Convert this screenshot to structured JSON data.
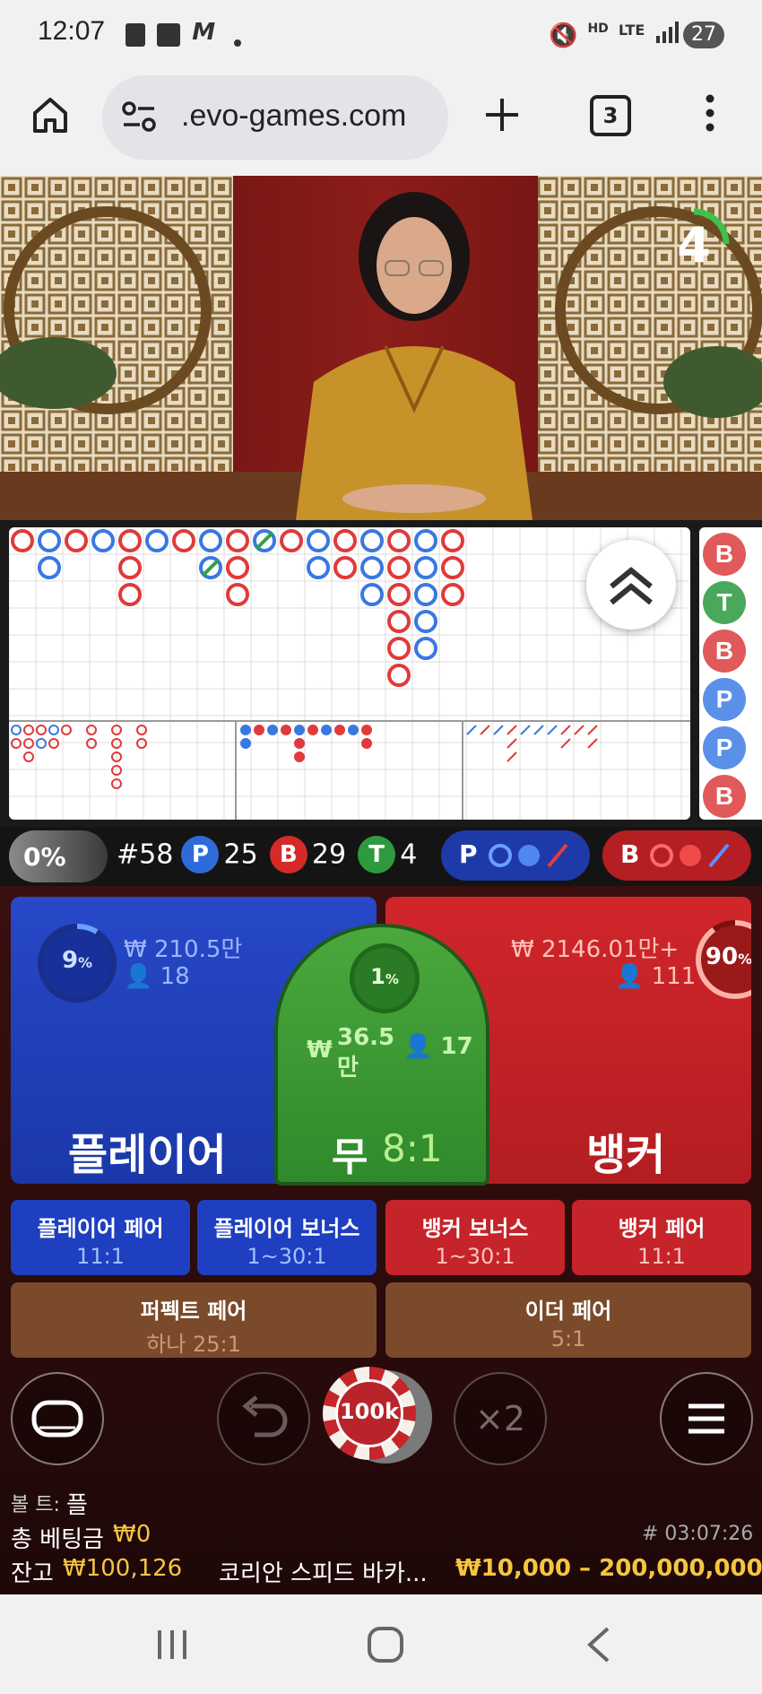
{
  "status_bar": {
    "time": "12:07",
    "battery": "27"
  },
  "browser": {
    "url": ".evo-games.com",
    "tab_count": "3"
  },
  "video": {
    "countdown": "4"
  },
  "roadmap": {
    "side_results": [
      "B",
      "T",
      "B",
      "P",
      "P",
      "B"
    ]
  },
  "stats": {
    "percent": "0%",
    "round": "#58",
    "player_label": "P",
    "player_count": "25",
    "banker_label": "B",
    "banker_count": "29",
    "tie_label": "T",
    "tie_count": "4",
    "player_predict": "P",
    "banker_predict": "B"
  },
  "player": {
    "pct": "9",
    "pct_unit": "%",
    "amount": "₩ 210.5만",
    "count": "18",
    "title": "플레이어"
  },
  "tie": {
    "pct": "1",
    "pct_unit": "%",
    "amount_symbol": "₩",
    "amount": "36.5",
    "amount_unit": "만",
    "count": "17",
    "title": "무",
    "odds": "8:1"
  },
  "banker": {
    "pct": "90",
    "pct_unit": "%",
    "amount": "₩ 2146.01만+",
    "count": "111",
    "title": "뱅커"
  },
  "side_bets": [
    {
      "label": "플레이어 페어",
      "odds": "11:1"
    },
    {
      "label": "플레이어 보너스",
      "odds": "1~30:1"
    },
    {
      "label": "뱅커 보너스",
      "odds": "1~30:1"
    },
    {
      "label": "뱅커 페어",
      "odds": "11:1"
    }
  ],
  "pair_bets": [
    {
      "label": "퍼펙트 페어",
      "odds": "하나 25:1"
    },
    {
      "label": "이더 페어",
      "odds": "5:1"
    }
  ],
  "controls": {
    "chip": "100k",
    "double": "×2"
  },
  "info": {
    "bolt_label": "볼 트:",
    "bolt_value": "플",
    "total_bet_label": "총 베팅금",
    "total_bet_value": "₩0",
    "round_id": "# 03:07:26",
    "balance_label": "잔고",
    "balance_value": "₩100,126",
    "game_name": "코리안 스피드 바카...",
    "limits": "₩10,000 – 200,000,000"
  },
  "colors": {
    "player_blue": "#1f43c8",
    "banker_red": "#c8262b",
    "tie_green": "#3c9a3a",
    "gold": "#f5c542"
  }
}
